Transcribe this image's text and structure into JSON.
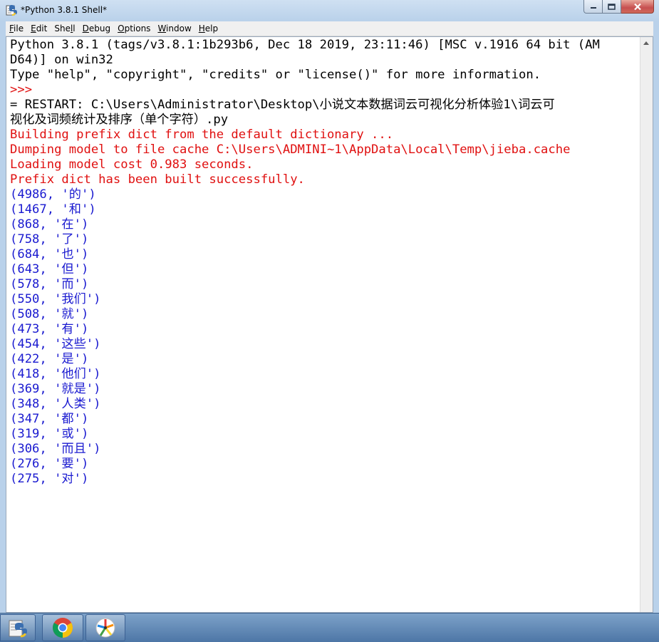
{
  "window": {
    "title": "*Python 3.8.1 Shell*"
  },
  "menu": {
    "items": [
      {
        "label": "File",
        "underline": "F"
      },
      {
        "label": "Edit",
        "underline": "E"
      },
      {
        "label": "Shell",
        "underline": "S"
      },
      {
        "label": "Debug",
        "underline": "D"
      },
      {
        "label": "Options",
        "underline": "O"
      },
      {
        "label": "Window",
        "underline": "W"
      },
      {
        "label": "Help",
        "underline": "H"
      }
    ]
  },
  "shell": {
    "lines": [
      {
        "text": "Python 3.8.1 (tags/v3.8.1:1b293b6, Dec 18 2019, 23:11:46) [MSC v.1916 64 bit (AM",
        "style": "black"
      },
      {
        "text": "D64)] on win32",
        "style": "black"
      },
      {
        "text": "Type \"help\", \"copyright\", \"credits\" or \"license()\" for more information.",
        "style": "black"
      },
      {
        "text": ">>>",
        "style": "red"
      },
      {
        "text": "= RESTART: C:\\Users\\Administrator\\Desktop\\小说文本数据词云可视化分析体验1\\词云可",
        "style": "black"
      },
      {
        "text": "视化及词频统计及排序（单个字符）.py",
        "style": "black"
      },
      {
        "text": "Building prefix dict from the default dictionary ...",
        "style": "red"
      },
      {
        "text": "Dumping model to file cache C:\\Users\\ADMINI~1\\AppData\\Local\\Temp\\jieba.cache",
        "style": "red"
      },
      {
        "text": "Loading model cost 0.983 seconds.",
        "style": "red"
      },
      {
        "text": "Prefix dict has been built successfully.",
        "style": "red"
      },
      {
        "text": "(4986, '的')",
        "style": "blue"
      },
      {
        "text": "(1467, '和')",
        "style": "blue"
      },
      {
        "text": "(868, '在')",
        "style": "blue"
      },
      {
        "text": "(758, '了')",
        "style": "blue"
      },
      {
        "text": "(684, '也')",
        "style": "blue"
      },
      {
        "text": "(643, '但')",
        "style": "blue"
      },
      {
        "text": "(578, '而')",
        "style": "blue"
      },
      {
        "text": "(550, '我们')",
        "style": "blue"
      },
      {
        "text": "(508, '就')",
        "style": "blue"
      },
      {
        "text": "(473, '有')",
        "style": "blue"
      },
      {
        "text": "(454, '这些')",
        "style": "blue"
      },
      {
        "text": "(422, '是')",
        "style": "blue"
      },
      {
        "text": "(418, '他们')",
        "style": "blue"
      },
      {
        "text": "(369, '就是')",
        "style": "blue"
      },
      {
        "text": "(348, '人类')",
        "style": "blue"
      },
      {
        "text": "(347, '都')",
        "style": "blue"
      },
      {
        "text": "(319, '或')",
        "style": "blue"
      },
      {
        "text": "(306, '而且')",
        "style": "blue"
      },
      {
        "text": "(276, '要')",
        "style": "blue"
      },
      {
        "text": "(275, '对')",
        "style": "blue"
      }
    ]
  },
  "colors": {
    "prompt_red": "#e01010",
    "output_blue": "#1a1ad0",
    "text_black": "#000000"
  },
  "taskbar": {
    "apps": [
      {
        "name": "python-idle-icon"
      },
      {
        "name": "chrome-icon"
      },
      {
        "name": "pinwheel-app-icon"
      }
    ]
  }
}
